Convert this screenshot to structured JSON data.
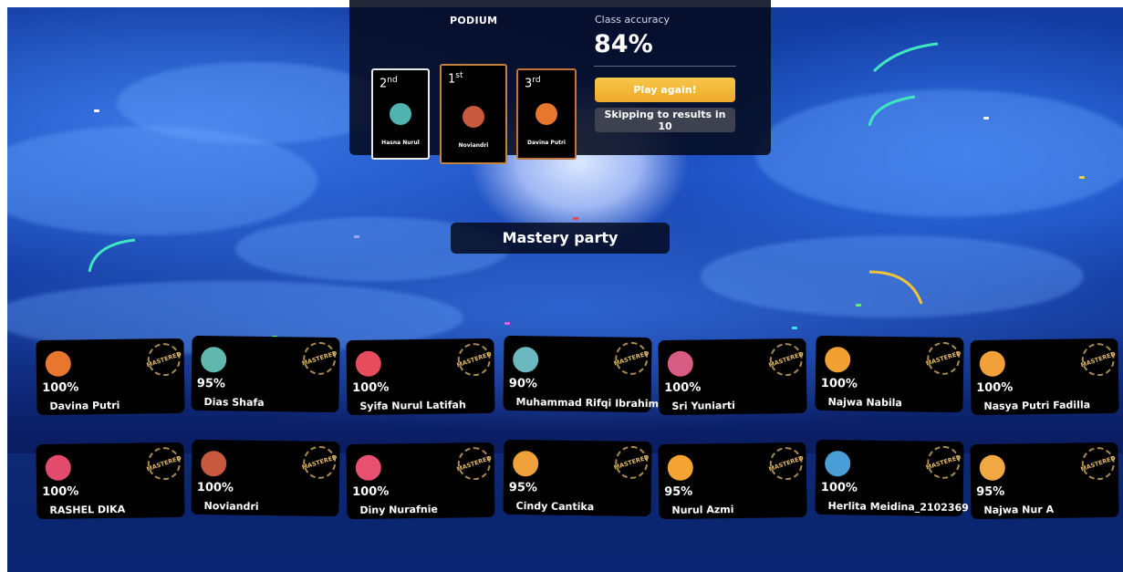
{
  "podium": {
    "title": "PODIUM",
    "places": [
      {
        "rank": "2",
        "suffix": "nd",
        "name": "Hasna Nurul",
        "avatar_color": "#4fb3b0"
      },
      {
        "rank": "1",
        "suffix": "st",
        "name": "Noviandri",
        "avatar_color": "#c8593f"
      },
      {
        "rank": "3",
        "suffix": "rd",
        "name": "Davina Putri",
        "avatar_color": "#e8772e"
      }
    ]
  },
  "accuracy": {
    "label": "Class accuracy",
    "value": "84%"
  },
  "buttons": {
    "play_again": "Play again!",
    "skip": "Skipping to results in 10"
  },
  "mastery": {
    "title": "Mastery party",
    "badge_text": "MASTERED"
  },
  "players": [
    {
      "name": "Davina Putri",
      "pct": "100%",
      "color": "#e8772e"
    },
    {
      "name": "Dias Shafa",
      "pct": "95%",
      "color": "#5fb7ae"
    },
    {
      "name": "Syifa Nurul Latifah",
      "pct": "100%",
      "color": "#e74c5c"
    },
    {
      "name": "Muhammad Rifqi Ibrahim",
      "pct": "90%",
      "color": "#6bb8c0"
    },
    {
      "name": "Sri Yuniarti",
      "pct": "100%",
      "color": "#d85b84"
    },
    {
      "name": "Najwa Nabila",
      "pct": "100%",
      "color": "#f0a132"
    },
    {
      "name": "Nasya Putri Fadilla",
      "pct": "100%",
      "color": "#f2a03a"
    },
    {
      "name": "RASHEL DIKA",
      "pct": "100%",
      "color": "#e24b6b"
    },
    {
      "name": "Noviandri",
      "pct": "100%",
      "color": "#c8593f"
    },
    {
      "name": "Diny Nurafnie",
      "pct": "100%",
      "color": "#e85070"
    },
    {
      "name": "Cindy Cantika",
      "pct": "95%",
      "color": "#f0a23a"
    },
    {
      "name": "Nurul Azmi",
      "pct": "95%",
      "color": "#f5a431"
    },
    {
      "name": "Herlita Meidina_2102369",
      "pct": "100%",
      "color": "#4a9ed8"
    },
    {
      "name": "Najwa Nur A",
      "pct": "95%",
      "color": "#f2a842"
    }
  ]
}
